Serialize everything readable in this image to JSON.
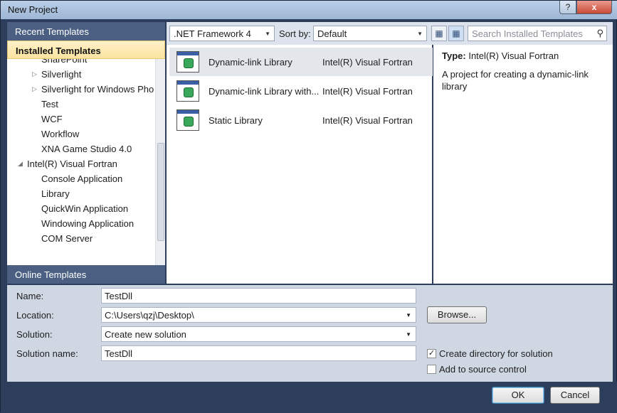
{
  "window": {
    "title": "New Project",
    "help_glyph": "?",
    "close_glyph": "x"
  },
  "left_panel": {
    "recent_templates": "Recent Templates",
    "installed_templates": "Installed Templates",
    "online_templates": "Online Templates",
    "tree": [
      {
        "label": "SharePoint",
        "indent": 2,
        "arrow": ""
      },
      {
        "label": "Silverlight",
        "indent": 2,
        "arrow": "▷"
      },
      {
        "label": "Silverlight for Windows Pho",
        "indent": 2,
        "arrow": "▷"
      },
      {
        "label": "Test",
        "indent": 2,
        "arrow": ""
      },
      {
        "label": "WCF",
        "indent": 2,
        "arrow": ""
      },
      {
        "label": "Workflow",
        "indent": 2,
        "arrow": ""
      },
      {
        "label": "XNA Game Studio 4.0",
        "indent": 2,
        "arrow": ""
      },
      {
        "label": "Intel(R) Visual Fortran",
        "indent": 1,
        "arrow": "◢"
      },
      {
        "label": "Console Application",
        "indent": 2,
        "arrow": ""
      },
      {
        "label": "Library",
        "indent": 2,
        "arrow": ""
      },
      {
        "label": "QuickWin Application",
        "indent": 2,
        "arrow": ""
      },
      {
        "label": "Windowing Application",
        "indent": 2,
        "arrow": ""
      },
      {
        "label": "COM Server",
        "indent": 2,
        "arrow": ""
      }
    ]
  },
  "toolbar": {
    "framework": ".NET Framework 4",
    "sort_label": "Sort by:",
    "sort_value": "Default",
    "search_placeholder": "Search Installed Templates"
  },
  "templates": [
    {
      "name": "Dynamic-link Library",
      "language": "Intel(R) Visual Fortran",
      "selected": true
    },
    {
      "name": "Dynamic-link Library with...",
      "language": "Intel(R) Visual Fortran",
      "selected": false
    },
    {
      "name": "Static Library",
      "language": "Intel(R) Visual Fortran",
      "selected": false
    }
  ],
  "details": {
    "type_label": "Type:",
    "type_value": "Intel(R) Visual Fortran",
    "description": "A project for creating a dynamic-link library"
  },
  "form": {
    "name_label": "Name:",
    "name_value": "TestDll",
    "location_label": "Location:",
    "location_value": "C:\\Users\\qzj\\Desktop\\",
    "solution_label": "Solution:",
    "solution_value": "Create new solution",
    "solution_name_label": "Solution name:",
    "solution_name_value": "TestDll",
    "browse_label": "Browse...",
    "create_directory_label": "Create directory for solution",
    "create_directory_checked": true,
    "source_control_label": "Add to source control",
    "source_control_checked": false
  },
  "buttons": {
    "ok": "OK",
    "cancel": "Cancel"
  }
}
